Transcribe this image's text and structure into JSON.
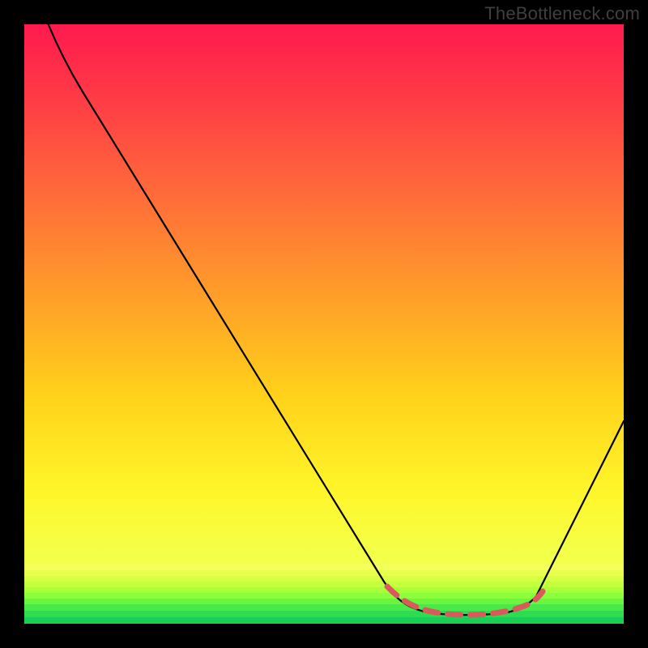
{
  "watermark": "TheBottleneck.com",
  "chart_data": {
    "type": "line",
    "title": "",
    "xlabel": "",
    "ylabel": "",
    "xlim": [
      0,
      100
    ],
    "ylim": [
      0,
      100
    ],
    "grid": false,
    "plot_background": {
      "top_color": "#ff1a4e",
      "through_colors": [
        "#ff6a3a",
        "#ffd21a",
        "#f4ff33",
        "#73ff3d"
      ],
      "bottom_color": "#18e056"
    },
    "series": [
      {
        "name": "bottleneck-curve",
        "color": "#000000",
        "stroke_width": 2,
        "points": [
          {
            "x": 4,
            "y": 100
          },
          {
            "x": 8,
            "y": 93
          },
          {
            "x": 12,
            "y": 86
          },
          {
            "x": 16,
            "y": 79
          },
          {
            "x": 20,
            "y": 72
          },
          {
            "x": 24,
            "y": 65
          },
          {
            "x": 28,
            "y": 58
          },
          {
            "x": 32,
            "y": 51
          },
          {
            "x": 36,
            "y": 44
          },
          {
            "x": 40,
            "y": 37
          },
          {
            "x": 44,
            "y": 30
          },
          {
            "x": 48,
            "y": 23
          },
          {
            "x": 52,
            "y": 16
          },
          {
            "x": 56,
            "y": 9
          },
          {
            "x": 60,
            "y": 3
          },
          {
            "x": 64,
            "y": 1
          },
          {
            "x": 68,
            "y": 1
          },
          {
            "x": 72,
            "y": 1
          },
          {
            "x": 76,
            "y": 1
          },
          {
            "x": 80,
            "y": 3
          },
          {
            "x": 84,
            "y": 10
          },
          {
            "x": 88,
            "y": 18
          },
          {
            "x": 92,
            "y": 26
          },
          {
            "x": 96,
            "y": 34
          },
          {
            "x": 100,
            "y": 42
          }
        ]
      },
      {
        "name": "sweet-spot-marker",
        "color": "#d85a5a",
        "stroke_width": 6,
        "dash": "14 10",
        "points": [
          {
            "x": 60,
            "y": 3
          },
          {
            "x": 64,
            "y": 1.5
          },
          {
            "x": 68,
            "y": 1
          },
          {
            "x": 72,
            "y": 1
          },
          {
            "x": 76,
            "y": 1.5
          },
          {
            "x": 80,
            "y": 3
          }
        ]
      }
    ],
    "gradient_bands_bottom": [
      {
        "y": 10,
        "color": "#f4ff5a"
      },
      {
        "y": 9,
        "color": "#e8ff4e"
      },
      {
        "y": 8,
        "color": "#d8ff44"
      },
      {
        "y": 7,
        "color": "#c4ff3e"
      },
      {
        "y": 6,
        "color": "#a8ff3a"
      },
      {
        "y": 5,
        "color": "#8cff3c"
      },
      {
        "y": 4,
        "color": "#6cf53e"
      },
      {
        "y": 3,
        "color": "#4ae848"
      },
      {
        "y": 2,
        "color": "#2edc50"
      },
      {
        "y": 1,
        "color": "#18d056"
      },
      {
        "y": 0,
        "color": "#12c452"
      }
    ]
  }
}
